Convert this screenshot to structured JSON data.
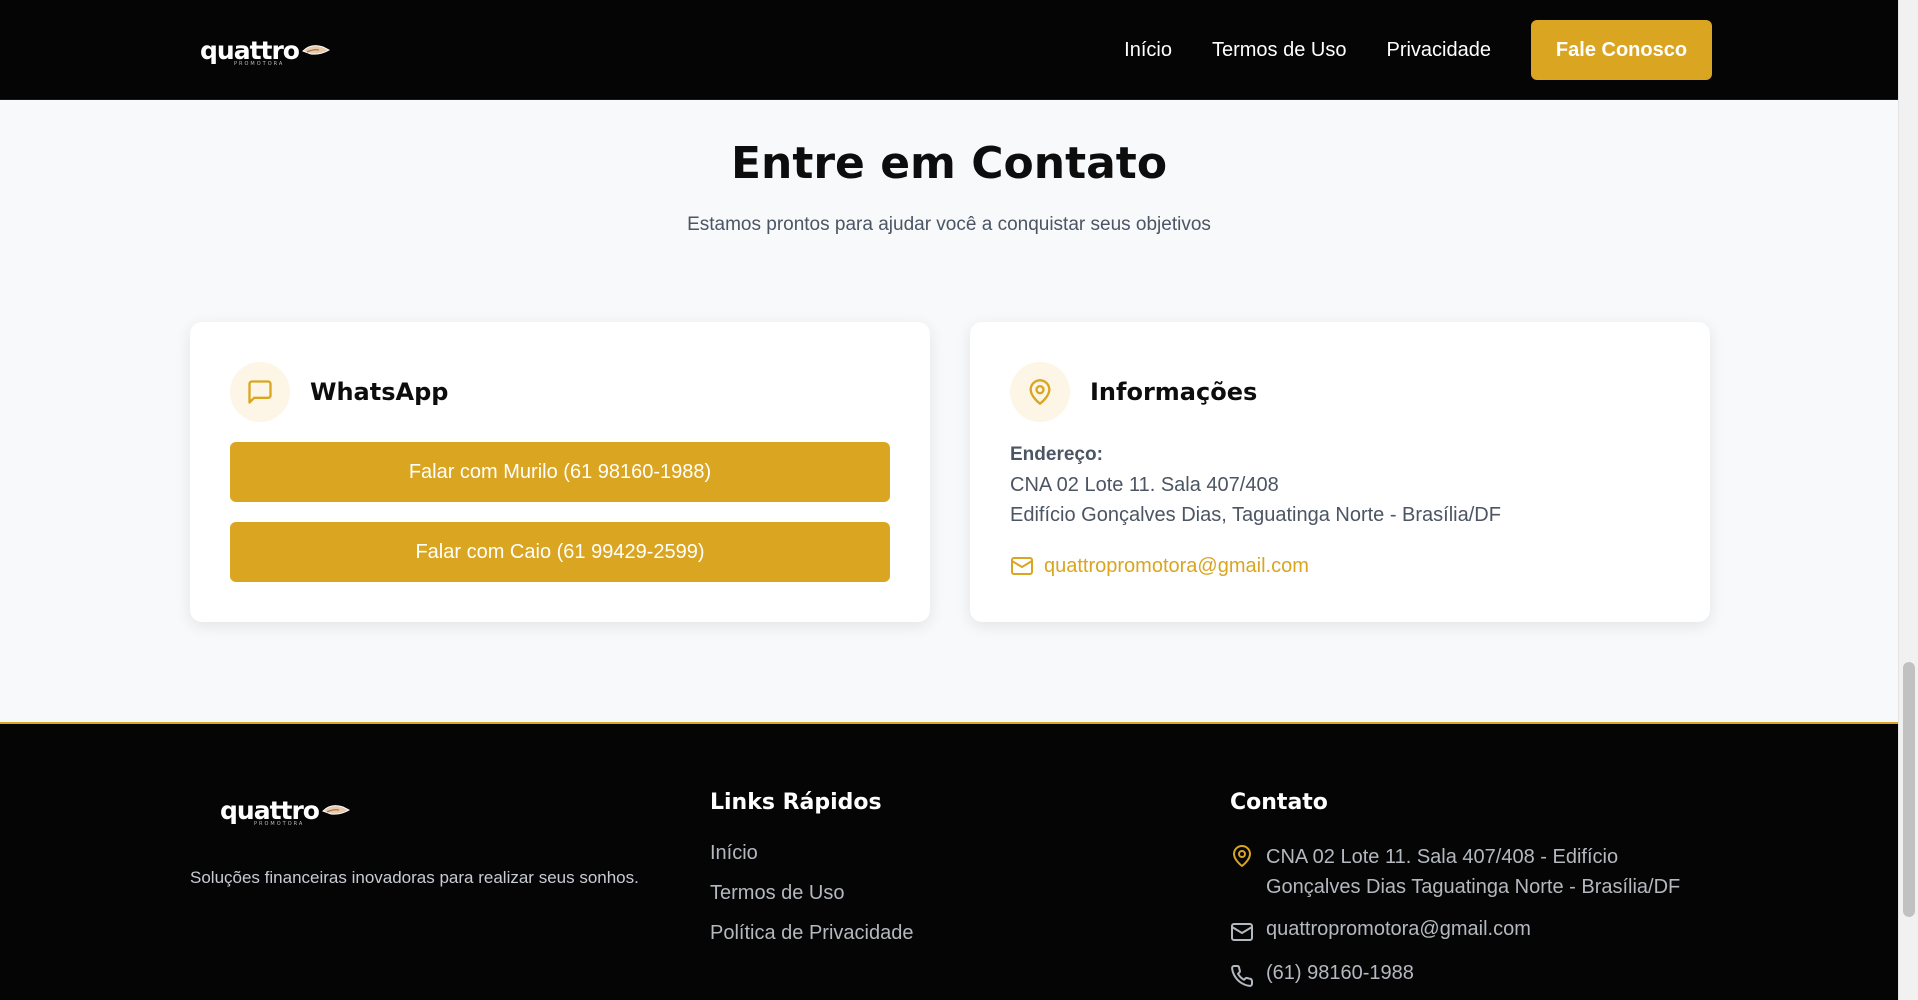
{
  "header": {
    "logo_text": "quattro",
    "logo_subtext": "PROMOTORA",
    "nav": [
      "Início",
      "Termos de Uso",
      "Privacidade"
    ],
    "cta_label": "Fale Conosco"
  },
  "contact": {
    "title": "Entre em Contato",
    "subtitle": "Estamos prontos para ajudar você a conquistar seus objetivos",
    "whatsapp": {
      "title": "WhatsApp",
      "buttons": [
        "Falar com Murilo (61 98160-1988)",
        "Falar com Caio (61 99429-2599)"
      ]
    },
    "info": {
      "title": "Informações",
      "address_label": "Endereço:",
      "address_lines": [
        "CNA 02 Lote 11. Sala 407/408",
        "Edifício Gonçalves Dias, Taguatinga Norte - Brasília/DF"
      ],
      "email": "quattropromotora@gmail.com"
    }
  },
  "footer": {
    "logo_text": "quattro",
    "logo_subtext": "PROMOTORA",
    "tagline": "Soluções financeiras inovadoras para realizar seus sonhos.",
    "links_title": "Links Rápidos",
    "links": [
      "Início",
      "Termos de Uso",
      "Política de Privacidade"
    ],
    "contact_title": "Contato",
    "address": "CNA 02 Lote 11. Sala 407/408 - Edifício Gonçalves Dias Taguatinga Norte - Brasília/DF",
    "email": "quattropromotora@gmail.com",
    "phone": "(61) 98160-1988"
  },
  "colors": {
    "accent": "#daa520",
    "dark": "#050505",
    "background": "#f8f9fb"
  },
  "icons": [
    "chat-bubble-icon",
    "location-pin-icon",
    "mail-icon",
    "phone-icon",
    "logo-hand-icon"
  ]
}
